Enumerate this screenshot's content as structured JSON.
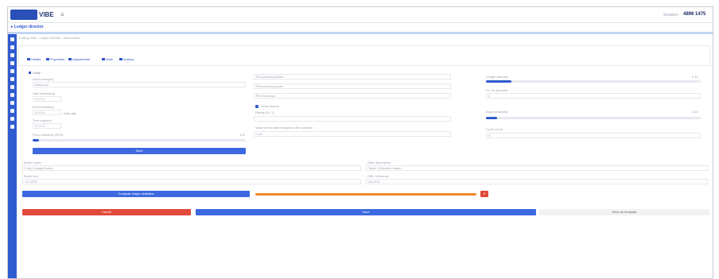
{
  "app": {
    "logo_text": "VIBE",
    "menu_icon": "hamburger-icon",
    "session_label": "Session:",
    "session_value": "4896 1475",
    "subtitle": "▸ Ledger director"
  },
  "breadcrumb": "Trading desk  ›  Ledger director  ›  Asset editor",
  "tabs": [
    {
      "label": "Details"
    },
    {
      "label": "Properties"
    },
    {
      "label": "Adjustments"
    },
    {
      "label": "Slots"
    },
    {
      "label": "Actions"
    }
  ],
  "hint": "Utility",
  "left_panel": {
    "fields": [
      {
        "label": "Asset category",
        "value": "Resource"
      },
      {
        "label": "Start timestamp",
        "value": "0  0  0  0"
      },
      {
        "label": "End timestamp",
        "value": "0  0  0  0",
        "extra": "Auto day"
      },
      {
        "label": "Time elapsed",
        "value": "0  0  0  0"
      }
    ],
    "slider": {
      "label": "Price tolerance (BPS)",
      "value": "0.5",
      "level": 0.03
    },
    "apply_button": "Save"
  },
  "middle_panel": {
    "fields": [
      {
        "label": "",
        "value": "Fill amount product"
      },
      {
        "label": "",
        "value": "Fill amount product"
      },
      {
        "label": "",
        "value": "Fill of product"
      }
    ],
    "checkbox_label": "Show history",
    "range": {
      "label": "Range (%, 1)",
      "value": ""
    },
    "spread": {
      "label": "Value of the state request of the contract",
      "value": "1.40"
    }
  },
  "right_panel": {
    "slider_top": {
      "label": "Ledger forecast",
      "value": "0.14",
      "level": 0.12
    },
    "field_top": {
      "label": "Ex: fill amounts",
      "value": "0"
    },
    "slider_mid": {
      "label": "Base sensitivity",
      "value": "0.14",
      "level": 0.05
    },
    "field_bottom": {
      "label": "Cycle count",
      "value": "0"
    }
  },
  "lower_fields": {
    "left_a": {
      "label": "Batch name",
      "value": "Fully Charged batch"
    },
    "right_a": {
      "label": "Offer description",
      "value": "Table: Scheduled batch"
    },
    "left_b": {
      "label": "Batch key",
      "value": "1.6.4576"
    },
    "right_b": {
      "label": "Offer reference",
      "value": "440.576"
    }
  },
  "action_row": {
    "compute_button": "Compute ledger statistics",
    "progress_level": 0.0,
    "delete_icon": "trash-icon"
  },
  "bottom_buttons": {
    "cancel": "Cancel",
    "save": "Save",
    "secondary": "Save as template"
  }
}
